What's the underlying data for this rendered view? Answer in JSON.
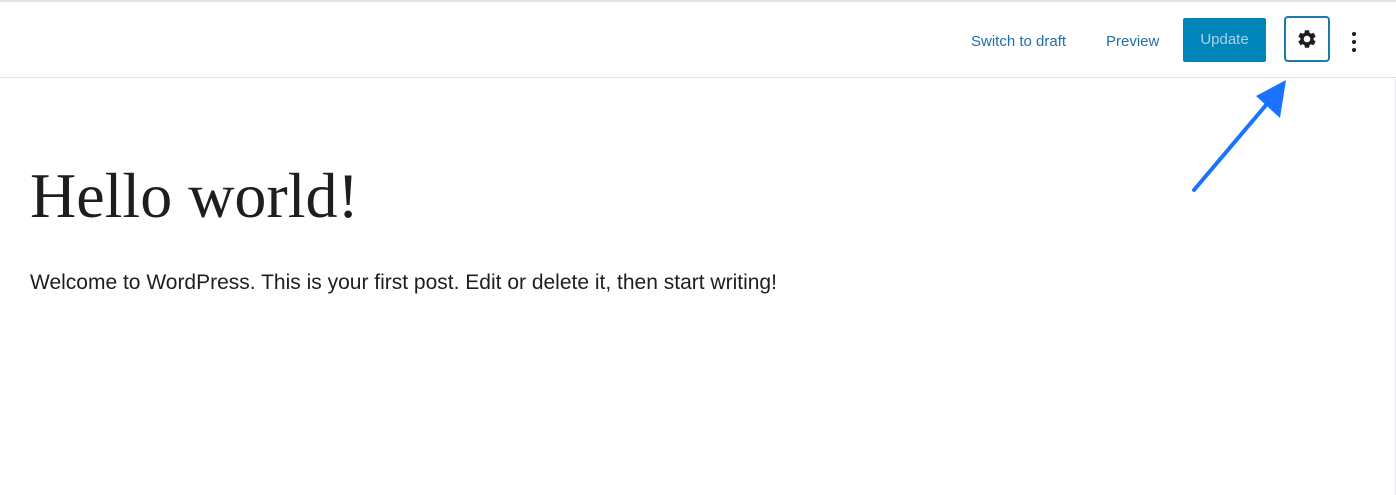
{
  "toolbar": {
    "switch_to_draft_label": "Switch to draft",
    "preview_label": "Preview",
    "update_label": "Update",
    "settings_icon": "gear-icon",
    "more_icon": "vertical-ellipsis-icon"
  },
  "post": {
    "title": "Hello world!",
    "body": "Welcome to WordPress. This is your first post. Edit or delete it, then start writing!"
  },
  "colors": {
    "link": "#1f6fa8",
    "update_button_bg": "#0085ba",
    "update_button_text": "#a9d3e6",
    "settings_border": "#1a7bb4",
    "annotation_arrow": "#1a73ff"
  }
}
